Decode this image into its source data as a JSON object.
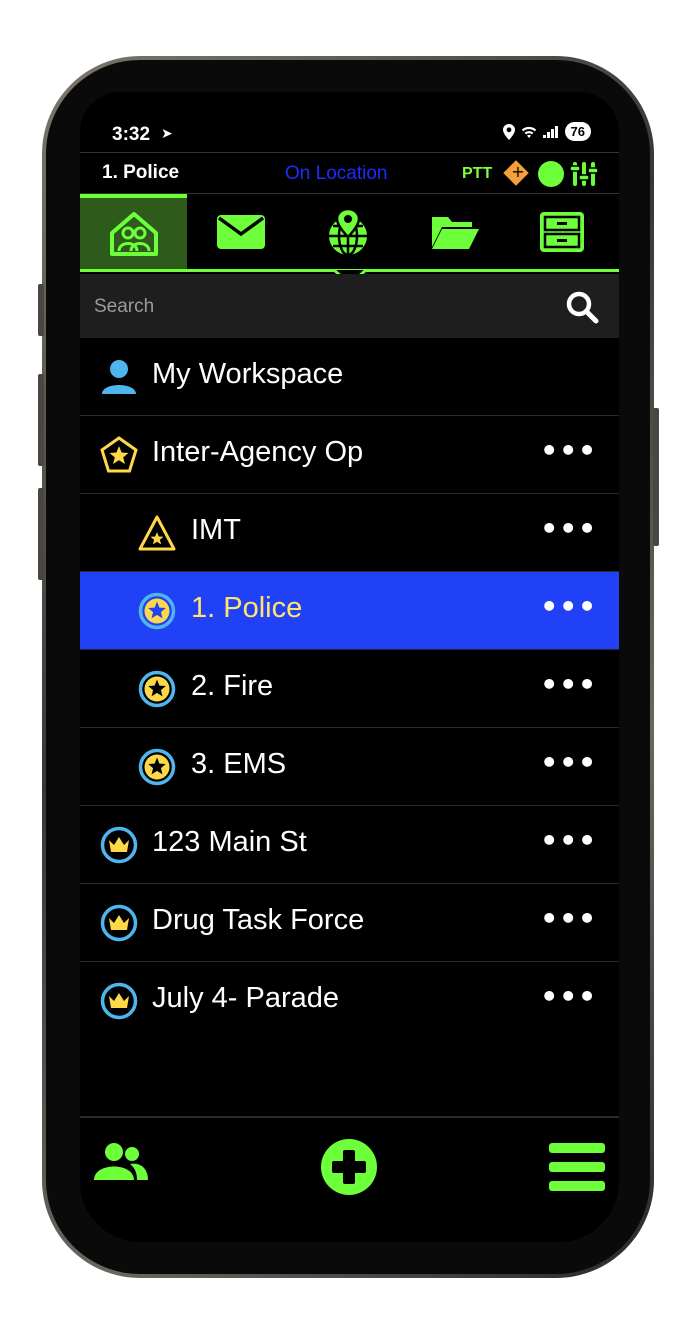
{
  "status_bar": {
    "time": "3:32",
    "time_icon": "navigation-arrow-icon",
    "battery": "76",
    "icons": [
      "location-icon",
      "wifi-icon",
      "signal-icon"
    ]
  },
  "info_row": {
    "unit_name": "1. Police",
    "status": "On Location",
    "ptt_label": "PTT"
  },
  "colors": {
    "accent": "#6cff3a",
    "selected_row": "#2141f6",
    "status_text": "#1c2bff",
    "badge_gold": "#ffe66a",
    "ring_blue": "#4fb5ef"
  },
  "tabs": [
    {
      "icon": "home-team-icon",
      "active": true
    },
    {
      "icon": "mail-icon",
      "active": false
    },
    {
      "icon": "globe-pin-icon",
      "active": false
    },
    {
      "icon": "folder-icon",
      "active": false
    },
    {
      "icon": "cabinet-icon",
      "active": false
    }
  ],
  "search": {
    "placeholder": "Search"
  },
  "list": [
    {
      "label": "My Workspace",
      "icon": "person-icon",
      "more": ""
    },
    {
      "label": "Inter-Agency Op",
      "icon": "pentagon-star-icon",
      "more": "•••"
    },
    {
      "label": "IMT",
      "icon": "triangle-star-icon",
      "more": "•••"
    },
    {
      "label": "1. Police",
      "icon": "circle-star-icon",
      "more": "•••",
      "selected": true
    },
    {
      "label": "2. Fire",
      "icon": "circle-star-icon",
      "more": "•••"
    },
    {
      "label": "3. EMS",
      "icon": "circle-star-icon",
      "more": "•••"
    },
    {
      "label": "123 Main St",
      "icon": "crown-icon",
      "more": "•••"
    },
    {
      "label": "Drug Task Force",
      "icon": "crown-icon",
      "more": "•••"
    },
    {
      "label": "July 4- Parade",
      "icon": "crown-icon",
      "more": "•••"
    }
  ],
  "bottom_bar": {
    "left_icon": "contacts-icon",
    "center_icon": "add-icon",
    "right_icon": "menu-icon"
  }
}
